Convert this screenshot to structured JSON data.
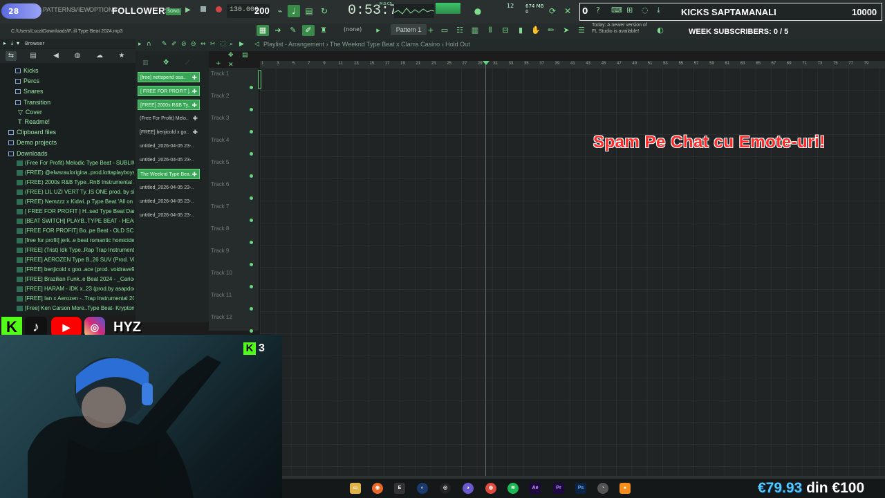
{
  "topbar": {
    "followers_badge": "28",
    "menu": [
      "PATTERNS",
      "VIEW",
      "OPTIONS"
    ],
    "followers_label": "FOLLOWERS",
    "song_badge": "SONG",
    "tempo": "130.000",
    "followers_count": "200",
    "time": "0:53:74",
    "time_small": "M:S:CS",
    "cpu": "12",
    "memory": "674 MB",
    "memory2": "0"
  },
  "kicks_panel": {
    "zero": "0",
    "label": "KICKS SAPTAMANALI",
    "goal": "10000"
  },
  "secondbar": {
    "file_path": "C:\\Users\\Luca\\Downloads\\F..ill Type Beat 2024.mp3",
    "snap": "(none)",
    "pattern": "Pattern 1",
    "update_line1": "Today: A newer version of",
    "update_line2": "FL Studio is available!",
    "week_subs": "WEEK SUBSCRIBERS: 0 / 5"
  },
  "browser": {
    "title": "Browser",
    "folders": [
      {
        "label": "Kicks"
      },
      {
        "label": "Percs"
      },
      {
        "label": "Snares"
      },
      {
        "label": "Transition"
      },
      {
        "label": "Cover"
      },
      {
        "label": "Readme!"
      },
      {
        "label": "Clipboard files"
      },
      {
        "label": "Demo projects"
      },
      {
        "label": "Downloads"
      }
    ],
    "files": [
      "(Free For Profit) Melodic Type Beat - SUBLIME",
      "(FREE) @elwsrauloriginа..prod.lottaplayboyshi",
      "(FREE) 2000s R&B Type..RnB Instrumental 2025",
      "(FREE) LIL UZI VERT Ty..IS ONE prod. by skadee",
      "(FREE) Nemzzz x Kidwi..p Type Beat 'All on You'",
      "[ FREE FOR PROFIT ] H..sed Type Beat Darkside",
      "[BEAT SWITCH] PLAYB..TYPE BEAT - HEADRUSH",
      "[FREE FOR PROFIT] Bo..pe Beat - OLD SCHOOL",
      "[free for profit] jerk..e beat romantic homicide",
      "[FREE] (Trist) Idk Type..Rap Trap Instrumental",
      "[FREE] AEROZEN Type B..26 SUV (Prod. Visssu)",
      "[FREE] benjicold x goo..ace (prod. voidrave99)",
      "[FREE] Brazilian Funk..e Beat 2024 - _Carioca_",
      "[FREE] HARAM - IDK x..23 (prod.by asapdodo)",
      "[FREE] Ian x Aerozen -..Trap Instrumental 2024",
      "[Free] Ken Carson More..Type Beat- Kryptonite"
    ]
  },
  "playlist": {
    "title": "Playlist - Arrangement",
    "breadcrumb1": "The Weeknd Type Beat x Clams Casino",
    "breadcrumb2": "Hold Out",
    "patterns": [
      {
        "label": "[free] nettspend osa..",
        "active": true
      },
      {
        "label": "[ FREE FOR PROFIT ]..",
        "active": true
      },
      {
        "label": "[FREE] 2000s R&B Ty..",
        "active": true
      },
      {
        "label": "(Free For Profit) Melo..",
        "active": false
      },
      {
        "label": "[FREE] benjicold x go..",
        "active": false
      },
      {
        "label": "untitled_2026-04-05 23-..",
        "active": false
      },
      {
        "label": "untitled_2026-04-05 23-..",
        "active": false
      },
      {
        "label": "The Weeknd Type Bea..",
        "active": true
      },
      {
        "label": "untitled_2026-04-05 23-..",
        "active": false
      },
      {
        "label": "untitled_2026-04-05 23-..",
        "active": false
      },
      {
        "label": "untitled_2026-04-05 23-..",
        "active": false
      }
    ],
    "tracks": [
      "Track 1",
      "Track 2",
      "Track 3",
      "Track 4",
      "Track 5",
      "Track 6",
      "Track 7",
      "Track 8",
      "Track 9",
      "Track 10",
      "Track 11",
      "Track 12"
    ],
    "ruler": [
      "1",
      "3",
      "5",
      "7",
      "9",
      "11",
      "13",
      "15",
      "17",
      "19",
      "21",
      "23",
      "25",
      "27",
      "29",
      "31",
      "33",
      "35",
      "37",
      "39",
      "41",
      "43",
      "45",
      "47",
      "49",
      "51",
      "53",
      "55",
      "57",
      "59",
      "61",
      "63",
      "65",
      "67",
      "69",
      "71",
      "73",
      "75",
      "77",
      "79"
    ]
  },
  "overlay": {
    "chat_message": "Spam Pe Chat cu Emote-uri!",
    "social_handle": "HYZ",
    "kick_viewers": "3",
    "donation_amount": "€79.93",
    "donation_sep": "din",
    "donation_goal": "€100"
  },
  "colors": {
    "accent": "#6bd183",
    "kick_green": "#53fc18",
    "chat_red": "#ff2b2b",
    "donation_blue": "#56c7ff"
  }
}
